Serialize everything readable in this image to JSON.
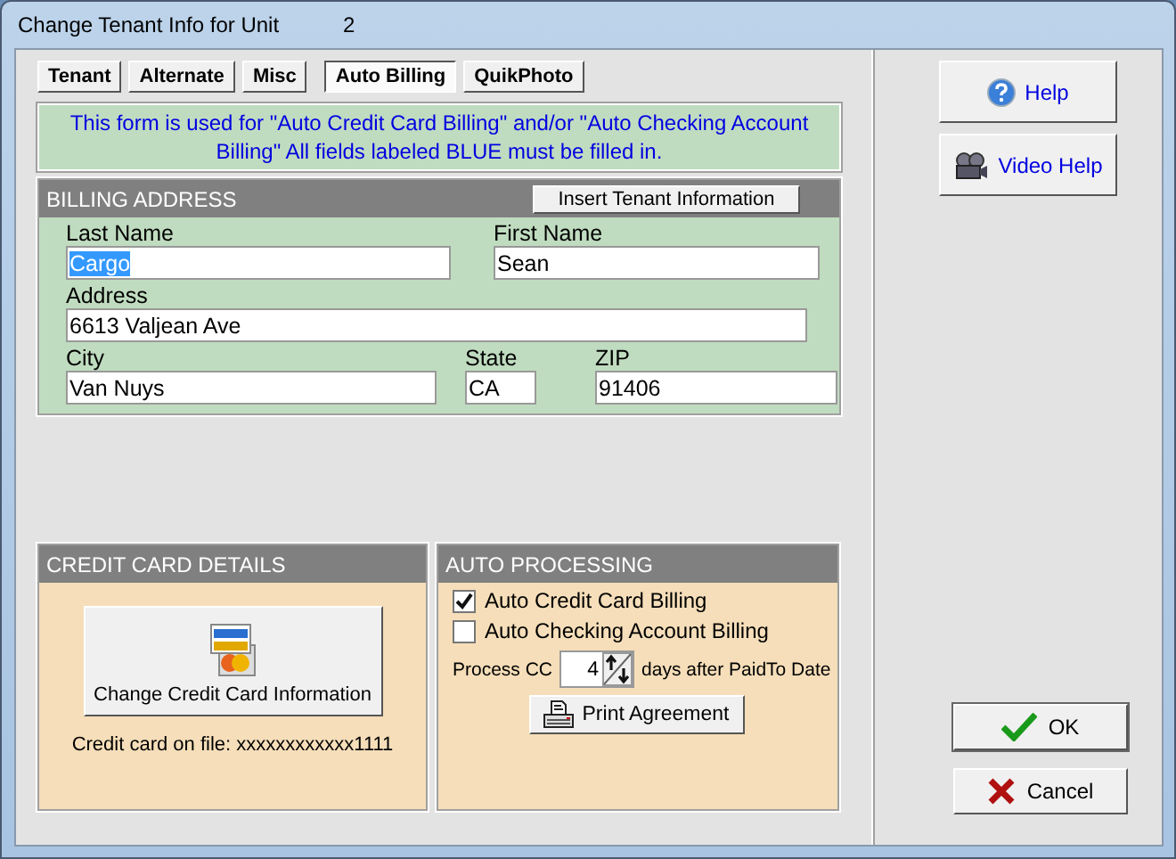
{
  "window": {
    "title": "Change Tenant Info for Unit",
    "unit": "2"
  },
  "tabs": [
    {
      "label": "Tenant",
      "selected": false
    },
    {
      "label": "Alternate",
      "selected": false
    },
    {
      "label": "Misc",
      "selected": false
    },
    {
      "label": "Auto Billing",
      "selected": true
    },
    {
      "label": "QuikPhoto",
      "selected": false
    }
  ],
  "notice": "This form is used for \"Auto Credit Card Billing\" and/or \"Auto Checking Account Billing\" All fields labeled BLUE must be filled in.",
  "billing_address": {
    "title": "BILLING ADDRESS",
    "insert_button": "Insert Tenant Information",
    "fields": [
      {
        "label": "Last Name",
        "value": "Cargo",
        "text_selected": true
      },
      {
        "label": "First Name",
        "value": "Sean",
        "text_selected": false
      },
      {
        "label": "Address",
        "value": "6613 Valjean Ave",
        "text_selected": false
      },
      {
        "label": "City",
        "value": "Van Nuys",
        "text_selected": false
      },
      {
        "label": "State",
        "value": "CA",
        "text_selected": false
      },
      {
        "label": "ZIP",
        "value": "91406",
        "text_selected": false
      }
    ]
  },
  "credit_card_details": {
    "title": "CREDIT CARD DETAILS",
    "button": "Change Credit Card Information",
    "card_on_file": "Credit card on file: xxxxxxxxxxxx1111"
  },
  "auto_processing": {
    "title": "AUTO PROCESSING",
    "options": [
      {
        "label": "Auto Credit Card Billing",
        "checked": true
      },
      {
        "label": "Auto Checking Account Billing",
        "checked": false
      }
    ],
    "process_label": "Process CC",
    "days_value": "4",
    "days_label": "days after PaidTo Date",
    "print_button": "Print Agreement"
  },
  "side_buttons": [
    {
      "kind": "help",
      "label": "Help"
    },
    {
      "kind": "video",
      "label": "Video Help"
    }
  ],
  "dialog_buttons": [
    {
      "kind": "ok",
      "label": "OK"
    },
    {
      "kind": "cancel",
      "label": "Cancel"
    }
  ]
}
